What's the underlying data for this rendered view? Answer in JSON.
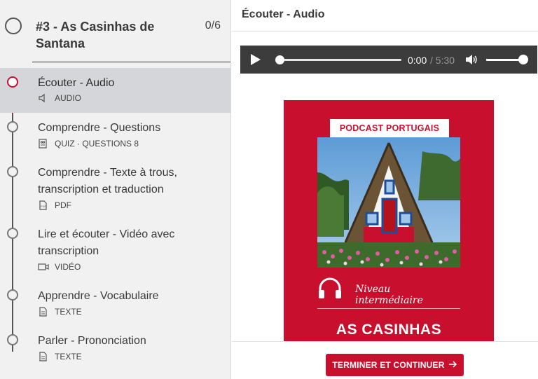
{
  "chapter": {
    "title": "#3 - As Casinhas de Santana",
    "progress": "0/6"
  },
  "lessons": [
    {
      "title": "Écouter - Audio",
      "meta": "AUDIO",
      "icon": "speaker-icon",
      "active": true
    },
    {
      "title": "Comprendre - Questions",
      "meta": "QUIZ · QUESTIONS  8",
      "icon": "quiz-icon",
      "active": false
    },
    {
      "title": "Comprendre - Texte à trous, transcription et traduction",
      "meta": "PDF",
      "icon": "pdf-icon",
      "active": false
    },
    {
      "title": "Lire et écouter - Vidéo avec transcription",
      "meta": "VIDÉO",
      "icon": "video-icon",
      "active": false
    },
    {
      "title": "Apprendre - Vocabulaire",
      "meta": "TEXTE",
      "icon": "text-doc-icon",
      "active": false
    },
    {
      "title": "Parler - Prononciation",
      "meta": "TEXTE",
      "icon": "text-doc-icon",
      "active": false
    }
  ],
  "main": {
    "title": "Écouter - Audio"
  },
  "player": {
    "current_time": "0:00",
    "duration": "/ 5:30",
    "progress": 0
  },
  "cover": {
    "tag": "PODCAST PORTUGAIS",
    "level": "Niveau intermédiaire",
    "name": "AS CASINHAS"
  },
  "footer": {
    "finish_label": "TERMINER ET CONTINUER"
  },
  "colors": {
    "accent": "#c8102e",
    "player_bg": "#3c3c3c",
    "sidebar_bg": "#f1f1f2"
  }
}
